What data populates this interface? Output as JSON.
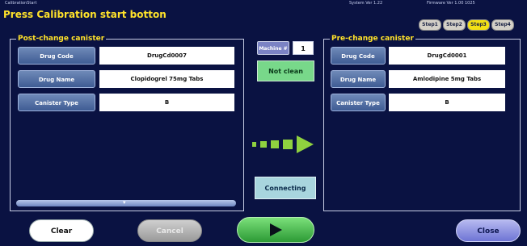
{
  "window": {
    "mini_title": "CalibrationStart",
    "system_version": "System Ver 1.22",
    "firmware_version": "Firmware Ver 1.00 1025",
    "instruction": "Press Calibration start botton"
  },
  "steps": [
    {
      "label": "Step1",
      "active": false
    },
    {
      "label": "Step2",
      "active": false
    },
    {
      "label": "Step3",
      "active": true
    },
    {
      "label": "Step4",
      "active": false
    }
  ],
  "post_change": {
    "title": "Post-change canister",
    "rows": [
      {
        "label": "Drug Code",
        "value": "DrugCd0007"
      },
      {
        "label": "Drug Name",
        "value": "Clopidogrel 75mg Tabs"
      },
      {
        "label": "Canister Type",
        "value": "B"
      }
    ]
  },
  "pre_change": {
    "title": "Pre-change canister",
    "rows": [
      {
        "label": "Drug Code",
        "value": "DrugCd0001"
      },
      {
        "label": "Drug Name",
        "value": "Amlodipine 5mg Tabs"
      },
      {
        "label": "Canister Type",
        "value": "B"
      }
    ]
  },
  "center": {
    "machine_label": "Machine #",
    "machine_value": "1",
    "not_clean_label": "Not clean",
    "connecting_label": "Connecting",
    "arrow_icon": "dashed-right-arrow-icon",
    "arrow_color": "#8fd13f"
  },
  "footer": {
    "clear_label": "Clear",
    "cancel_label": "Cancel",
    "start_icon": "play-icon",
    "close_label": "Close"
  },
  "colors": {
    "background": "#0a1242",
    "title_yellow": "#ffe22a",
    "start_green": "#2c9a35"
  }
}
